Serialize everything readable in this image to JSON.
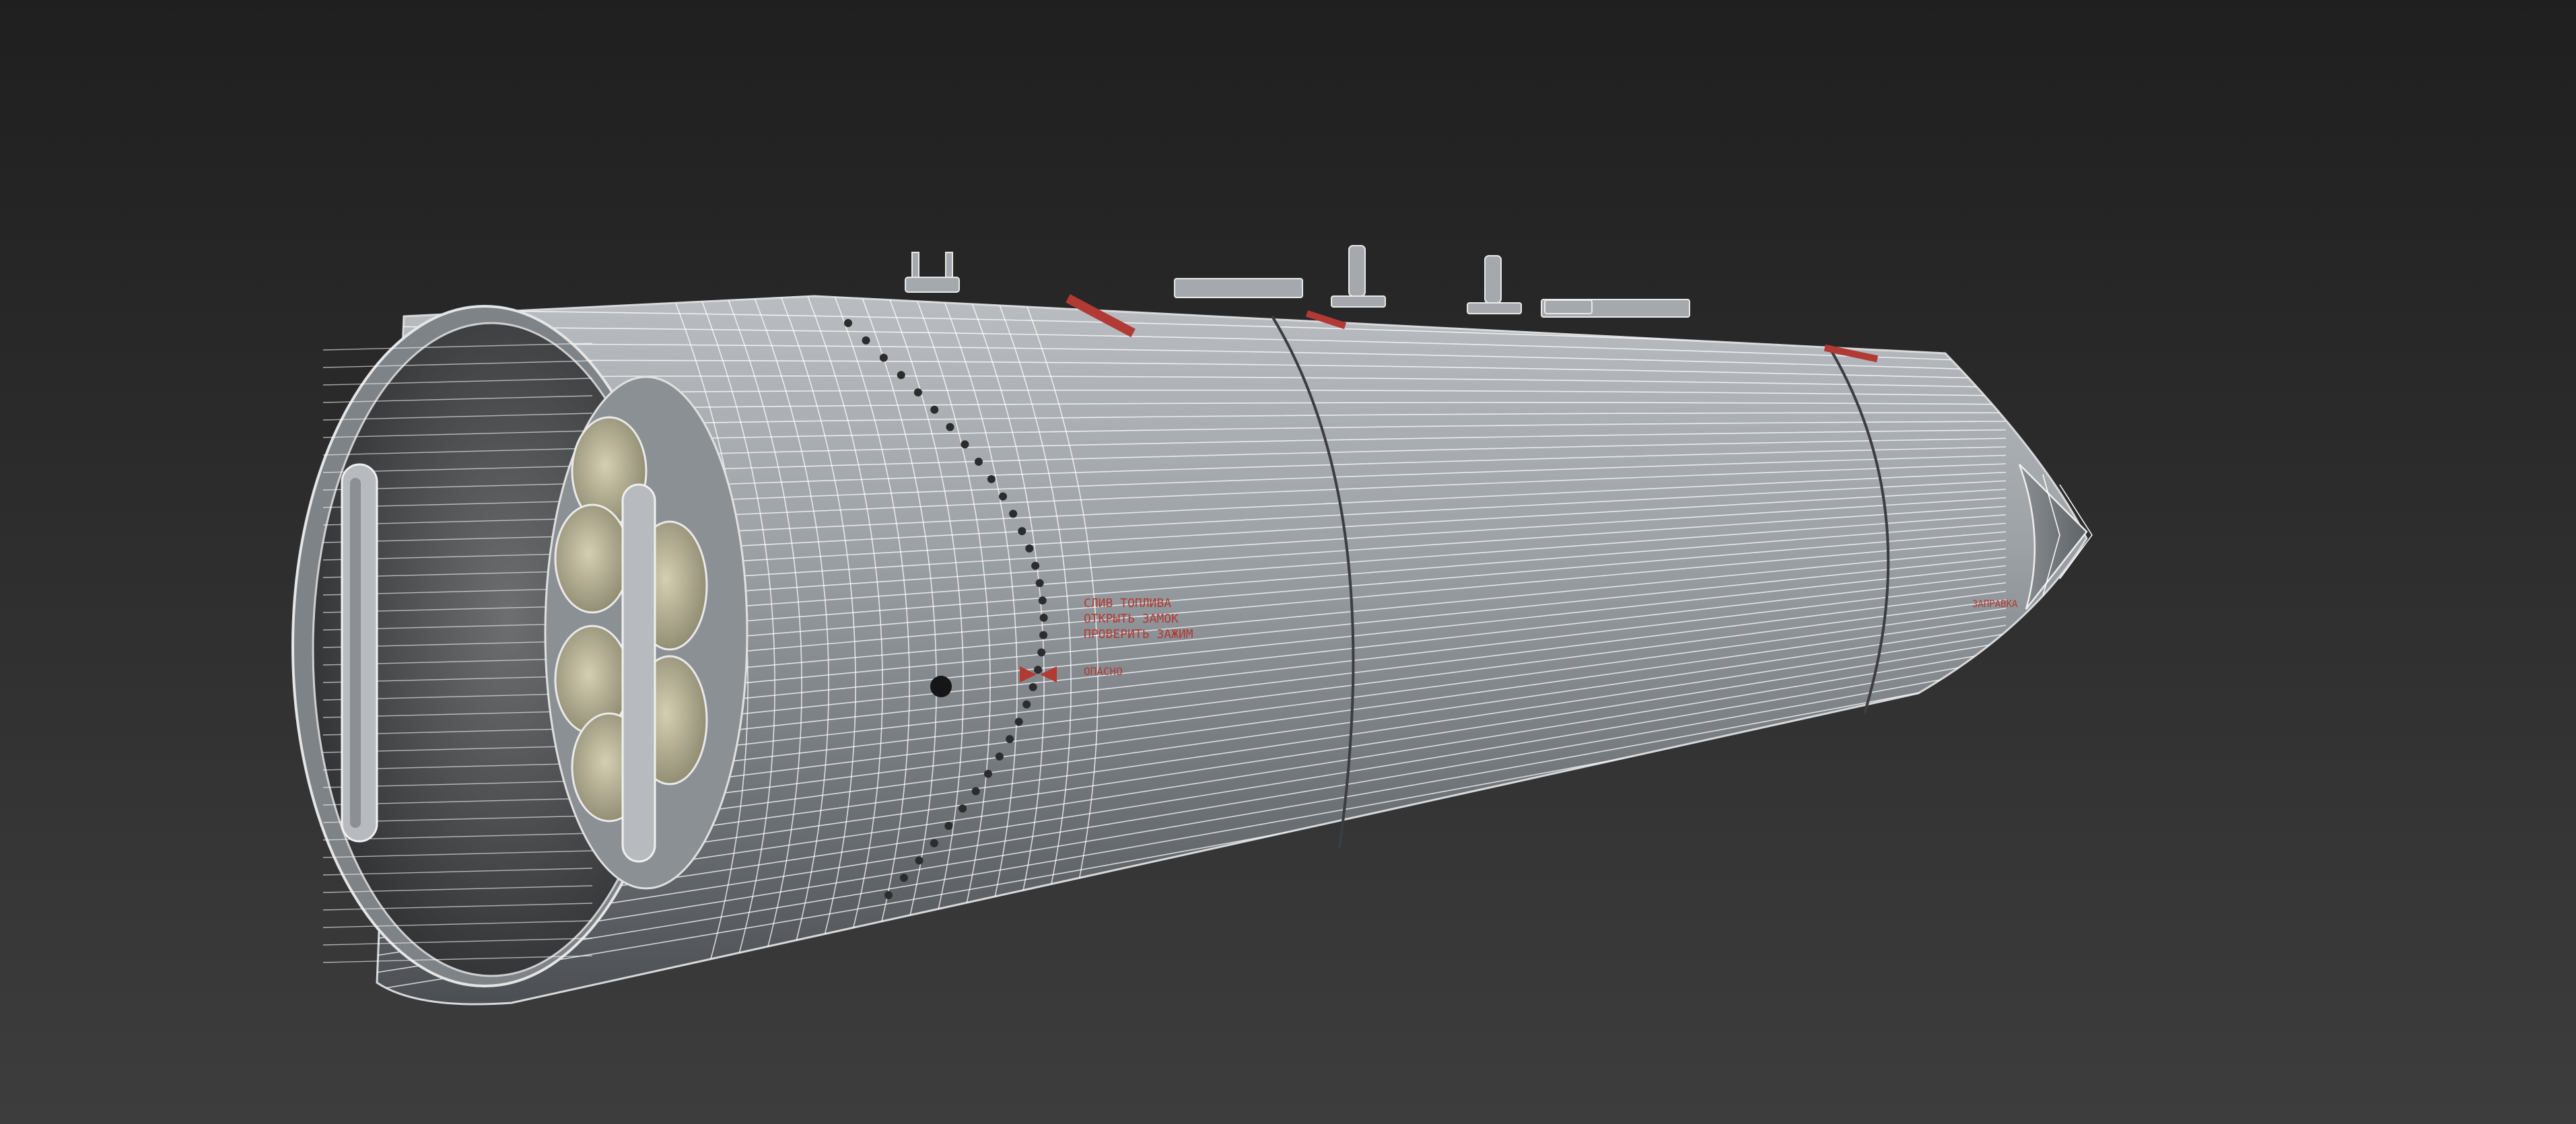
{
  "viewport": {
    "background_top": "#1f1f1f",
    "background_bottom": "#3d3d3d"
  },
  "model": {
    "body_color": "#8e9398",
    "wire_color": "#ffffff",
    "marking_color": "#b23a34",
    "tube_color": "#c8c3a6"
  },
  "markings": {
    "line1": "СЛИВ ТОПЛИВА",
    "line2": "ОТКРЫТЬ ЗАМОК",
    "line3": "ПРОВЕРИТЬ ЗАЖИМ",
    "line4": "ОПАСНО",
    "line5": "ЗАПРАВКА"
  }
}
